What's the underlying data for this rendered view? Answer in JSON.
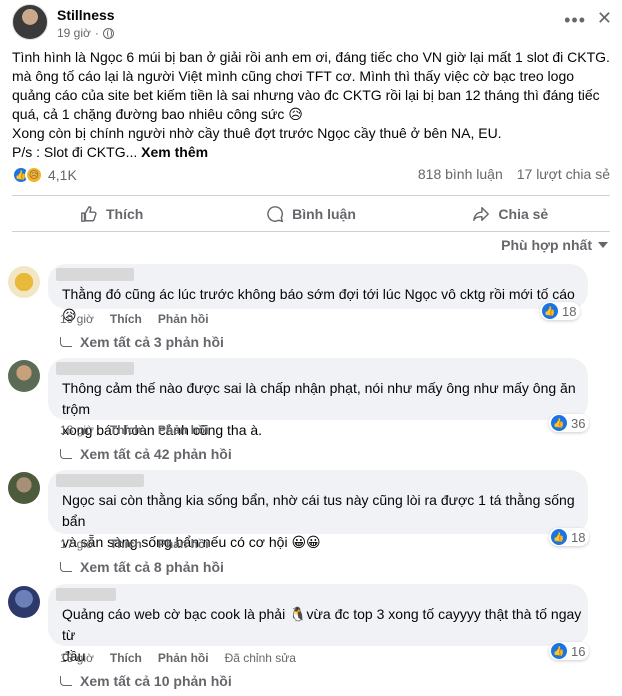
{
  "post": {
    "author": "Stillness",
    "time": "19 giờ",
    "privacy_icon": "globe-icon",
    "text_lines": [
      "Tình hình là Ngọc 6 múi bị ban ở giải rồi anh em ơi, đáng tiếc cho VN giờ lại mất 1 slot đi CKTG. mà ông tố cáo lại là người Việt mình cũng chơi TFT cơ. Mình thì thấy việc cờ bạc treo logo quảng cáo của site bet kiếm tiền là sai nhưng vào đc CKTG rồi lại bị ban 12 tháng thì đáng tiếc quá, cả 1 chặng đường bao nhiêu công sức 😥",
      "Xong còn bị chính người nhờ cầy thuê đợt trước Ngọc cầy thuê ở bên NA, EU.",
      "P/s : Slot đi CKTG..."
    ],
    "see_more": "Xem thêm",
    "reaction_count": "4,1K",
    "comment_count": "818 bình luận",
    "share_count": "17 lượt chia sẻ"
  },
  "actions": {
    "like": "Thích",
    "comment": "Bình luận",
    "share": "Chia sẻ"
  },
  "sort_label": "Phù hợp nhất",
  "comments": [
    {
      "text_lines": [
        "Thằng đó cũng ác lúc trước không báo sớm đợi tới lúc Ngọc vô cktg rồi mới tố cáo 😥"
      ],
      "time": "19 giờ",
      "like": "Thích",
      "reply": "Phản hồi",
      "edited": "",
      "reactions": "18",
      "view_replies": "Xem tất cả 3 phản hồi"
    },
    {
      "text_lines": [
        "Thông cảm thế nào được sai là chấp nhận phạt, nói như mấy ông như mấy ông ăn trộm",
        "xong báo hoàn cảnh cũng tha à."
      ],
      "time": "18 giờ",
      "like": "Thích",
      "reply": "Phản hồi",
      "edited": "",
      "reactions": "36",
      "view_replies": "Xem tất cả 42 phản hồi"
    },
    {
      "text_lines": [
        "Ngọc sai còn thằng kia sống bẩn, nhờ cái tus này cũng lòi ra được 1 tá thằng sống bẩn",
        "và sẵn sàng sống bẩn nếu có cơ hội 😀😀"
      ],
      "time": "17 giờ",
      "like": "Thích",
      "reply": "Phản hồi",
      "edited": "",
      "reactions": "18",
      "view_replies": "Xem tất cả 8 phản hồi"
    },
    {
      "text_lines": [
        "Quảng cáo web cờ bạc cook là phải 🐧vừa đc top 3 xong tố cayyyy thật thà tố ngay từ",
        "đầu"
      ],
      "time": "18 giờ",
      "like": "Thích",
      "reply": "Phản hồi",
      "edited": "Đã chỉnh sửa",
      "reactions": "16",
      "view_replies": "Xem tất cả 10 phản hồi"
    }
  ]
}
